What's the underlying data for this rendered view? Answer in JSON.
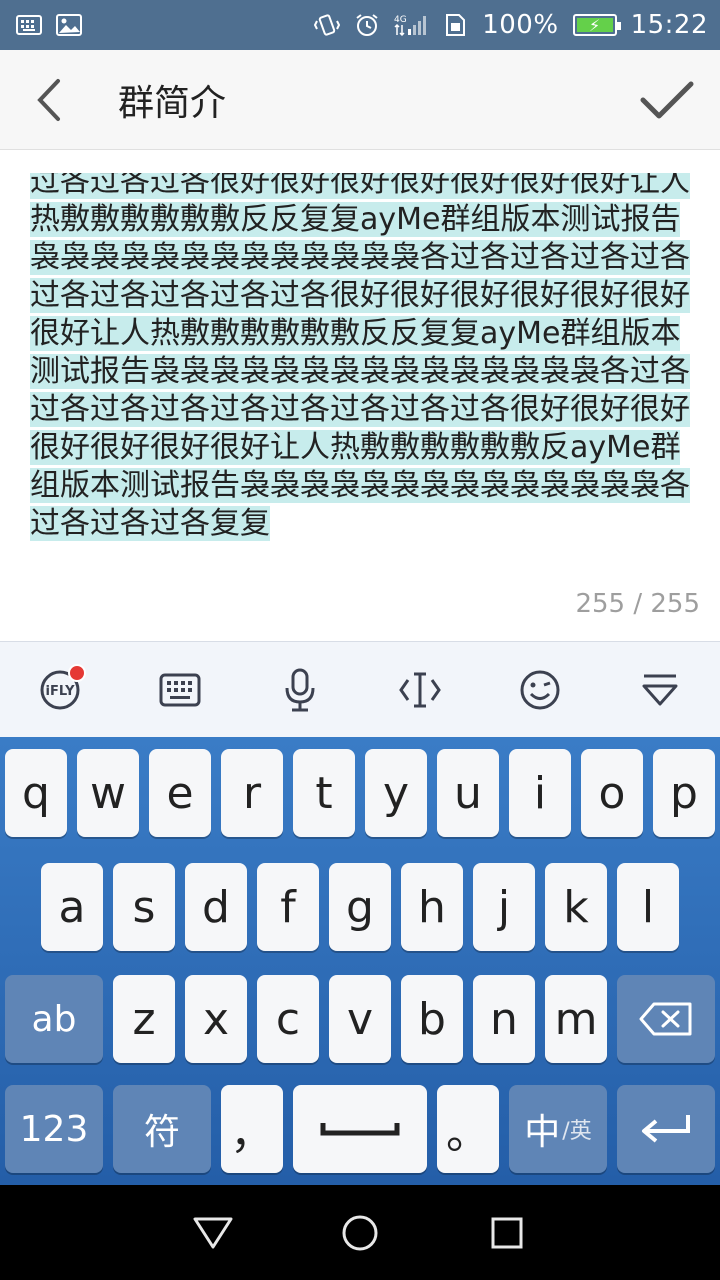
{
  "status": {
    "battery_text": "100%",
    "time": "15:22",
    "network": "4G"
  },
  "header": {
    "title": "群简介"
  },
  "editor": {
    "text": "过各过各过各很好很好很好很好很好很好很好让人热敷敷敷敷敷敷反反复复ayMe群组版本测试报告袅袅袅袅袅袅袅袅袅袅袅袅袅各过各过各过各过各过各过各过各过各过各很好很好很好很好很好很好很好让人热敷敷敷敷敷敷反反复复ayMe群组版本测试报告袅袅袅袅袅袅袅袅袅袅袅袅袅袅袅各过各过各过各过各过各过各过各过各过各很好很好很好很好很好很好很好让人热敷敷敷敷敷敷反ayMe群组版本测试报告袅袅袅袅袅袅袅袅袅袅袅袅袅袅各过各过各过各复复",
    "counter": "255 / 255"
  },
  "ime_toolbar": {
    "items": [
      "iflytek-icon",
      "keyboard-icon",
      "microphone-icon",
      "cursor-icon",
      "emoji-icon",
      "hide-keyboard-icon"
    ]
  },
  "keyboard": {
    "row1": [
      "q",
      "w",
      "e",
      "r",
      "t",
      "y",
      "u",
      "i",
      "o",
      "p"
    ],
    "row2": [
      "a",
      "s",
      "d",
      "f",
      "g",
      "h",
      "j",
      "k",
      "l"
    ],
    "row3": [
      "z",
      "x",
      "c",
      "v",
      "b",
      "n",
      "m"
    ],
    "shift_label": "ab",
    "numbers_label": "123",
    "symbols_label": "符",
    "comma_label": "，",
    "period_label": "。",
    "lang_main": "中",
    "lang_sub": "/英"
  },
  "colors": {
    "selection": "#c7ecec",
    "keyboard_bg": "#2f6db7",
    "status_bg": "#4f6f90",
    "badge": "#e53935"
  }
}
